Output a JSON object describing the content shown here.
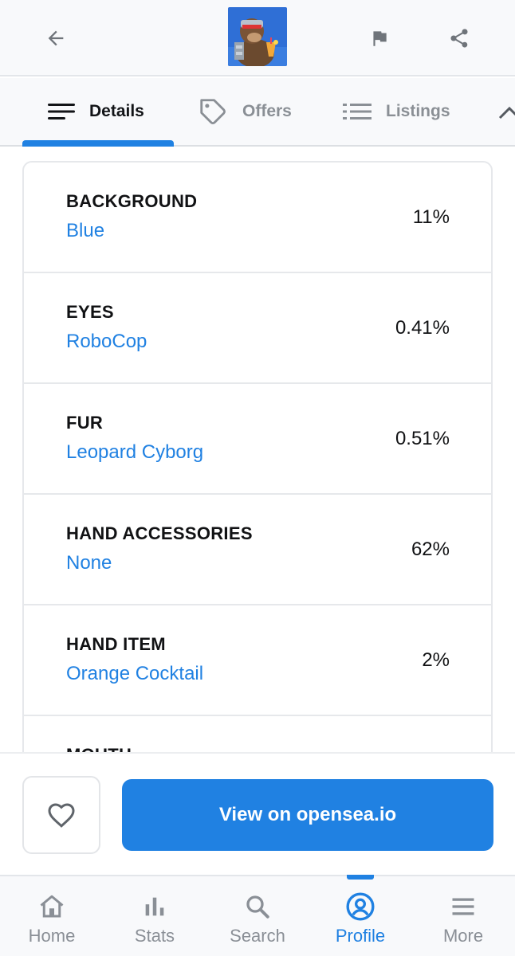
{
  "header": {
    "back_icon": "arrow-left-icon",
    "nft_image": "ape-cyborg-thumbnail",
    "flag_icon": "flag-icon",
    "share_icon": "share-icon"
  },
  "tabs": [
    {
      "label": "Details",
      "icon": "menu-lines-icon",
      "active": true
    },
    {
      "label": "Offers",
      "icon": "tag-icon",
      "active": false
    },
    {
      "label": "Listings",
      "icon": "list-icon",
      "active": false
    }
  ],
  "traits": [
    {
      "type": "BACKGROUND",
      "value": "Blue",
      "percent": "11%"
    },
    {
      "type": "EYES",
      "value": "RoboCop",
      "percent": "0.41%"
    },
    {
      "type": "FUR",
      "value": "Leopard Cyborg",
      "percent": "0.51%"
    },
    {
      "type": "HAND ACCESSORIES",
      "value": "None",
      "percent": "62%"
    },
    {
      "type": "HAND ITEM",
      "value": "Orange Cocktail",
      "percent": "2%"
    },
    {
      "type": "MOUTH",
      "value": "",
      "percent": ""
    }
  ],
  "actions": {
    "favorite_icon": "heart-icon",
    "view_label": "View on opensea.io"
  },
  "nav": [
    {
      "label": "Home",
      "icon": "home-icon"
    },
    {
      "label": "Stats",
      "icon": "bar-chart-icon"
    },
    {
      "label": "Search",
      "icon": "search-icon"
    },
    {
      "label": "Profile",
      "icon": "profile-icon",
      "active": true
    },
    {
      "label": "More",
      "icon": "hamburger-icon"
    }
  ],
  "colors": {
    "accent": "#2081e2",
    "text": "#111214",
    "muted": "#8a8f96"
  }
}
